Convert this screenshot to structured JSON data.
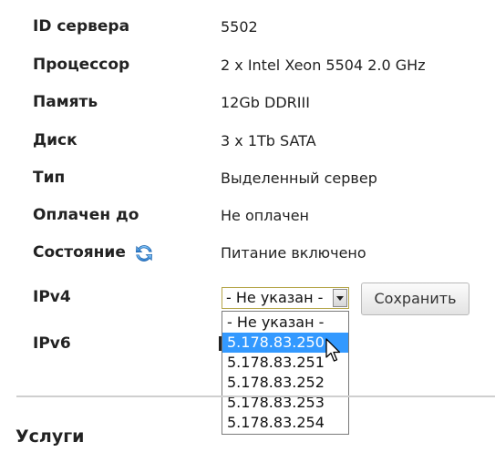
{
  "server_info": {
    "rows": [
      {
        "label": "ID сервера",
        "value": "5502"
      },
      {
        "label": "Процессор",
        "value": "2 x Intel Xeon 5504 2.0 GHz"
      },
      {
        "label": "Память",
        "value": "12Gb DDRIII"
      },
      {
        "label": "Диск",
        "value": "3 x 1Tb SATA"
      },
      {
        "label": "Тип",
        "value": "Выделенный сервер"
      },
      {
        "label": "Оплачен до",
        "value": "Не оплачен"
      },
      {
        "label": "Состояние",
        "value": "Питание включено"
      }
    ],
    "refresh_icon": "refresh-icon"
  },
  "ipv4": {
    "label": "IPv4",
    "selected": "- Не указан -",
    "options": [
      "- Не указан -",
      "5.178.83.250",
      "5.178.83.251",
      "5.178.83.252",
      "5.178.83.253",
      "5.178.83.254"
    ],
    "highlighted_option": "5.178.83.250",
    "save_label": "Сохранить"
  },
  "ipv6": {
    "label": "IPv6"
  },
  "services": {
    "title": "Услуги"
  },
  "colors": {
    "highlight": "#3399ff",
    "select_border": "#b5a64a",
    "divider": "#cfcfcf"
  }
}
